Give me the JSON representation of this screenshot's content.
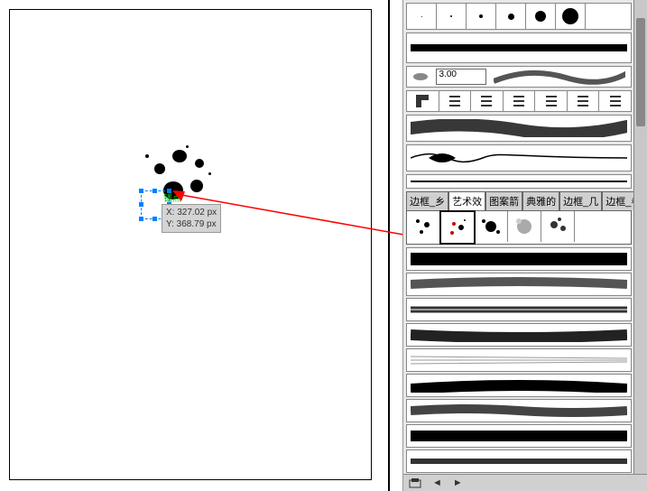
{
  "canvas": {
    "anchor_label": "锚点",
    "coord_x": "X: 327.02 px",
    "coord_y": "Y: 368.79 px"
  },
  "panel": {
    "size_value": "3.00",
    "tabs": [
      "边框_乡",
      "艺术效",
      "图案箭",
      "典雅的",
      "边框_几",
      "边框_卷"
    ],
    "selected_tab_index": 1,
    "footer": {
      "prev": "◄",
      "next": "►"
    }
  }
}
